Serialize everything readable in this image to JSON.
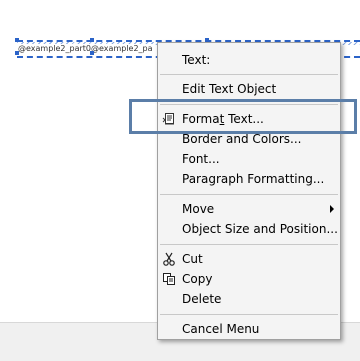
{
  "canvas": {
    "text_object_label": "@example2_part0@example2_pa"
  },
  "context_menu": {
    "items": [
      {
        "id": "text",
        "label": "Text:"
      },
      {
        "id": "edit-text-object",
        "label": "Edit Text Object"
      },
      {
        "id": "format-text",
        "label_before": "Forma",
        "label_mnemonic": "t",
        "label_after": " Text..."
      },
      {
        "id": "border-and-colors",
        "label": "Border and Colors..."
      },
      {
        "id": "font",
        "label": "Font..."
      },
      {
        "id": "paragraph-formatting",
        "label": "Paragraph Formatting..."
      },
      {
        "id": "move",
        "label": "Move"
      },
      {
        "id": "object-size-and-position",
        "label": "Object Size and Position..."
      },
      {
        "id": "cut",
        "label": "Cut"
      },
      {
        "id": "copy",
        "label": "Copy"
      },
      {
        "id": "delete",
        "label": "Delete"
      },
      {
        "id": "cancel-menu",
        "label": "Cancel Menu"
      }
    ]
  },
  "colors": {
    "highlight_border": "#5b7ea8",
    "selection_blue": "#2b63c8",
    "menu_background": "#f4f4f4"
  },
  "icons": [
    "format-text-icon",
    "scissors-icon",
    "copy-icon",
    "chevron-right-icon"
  ]
}
